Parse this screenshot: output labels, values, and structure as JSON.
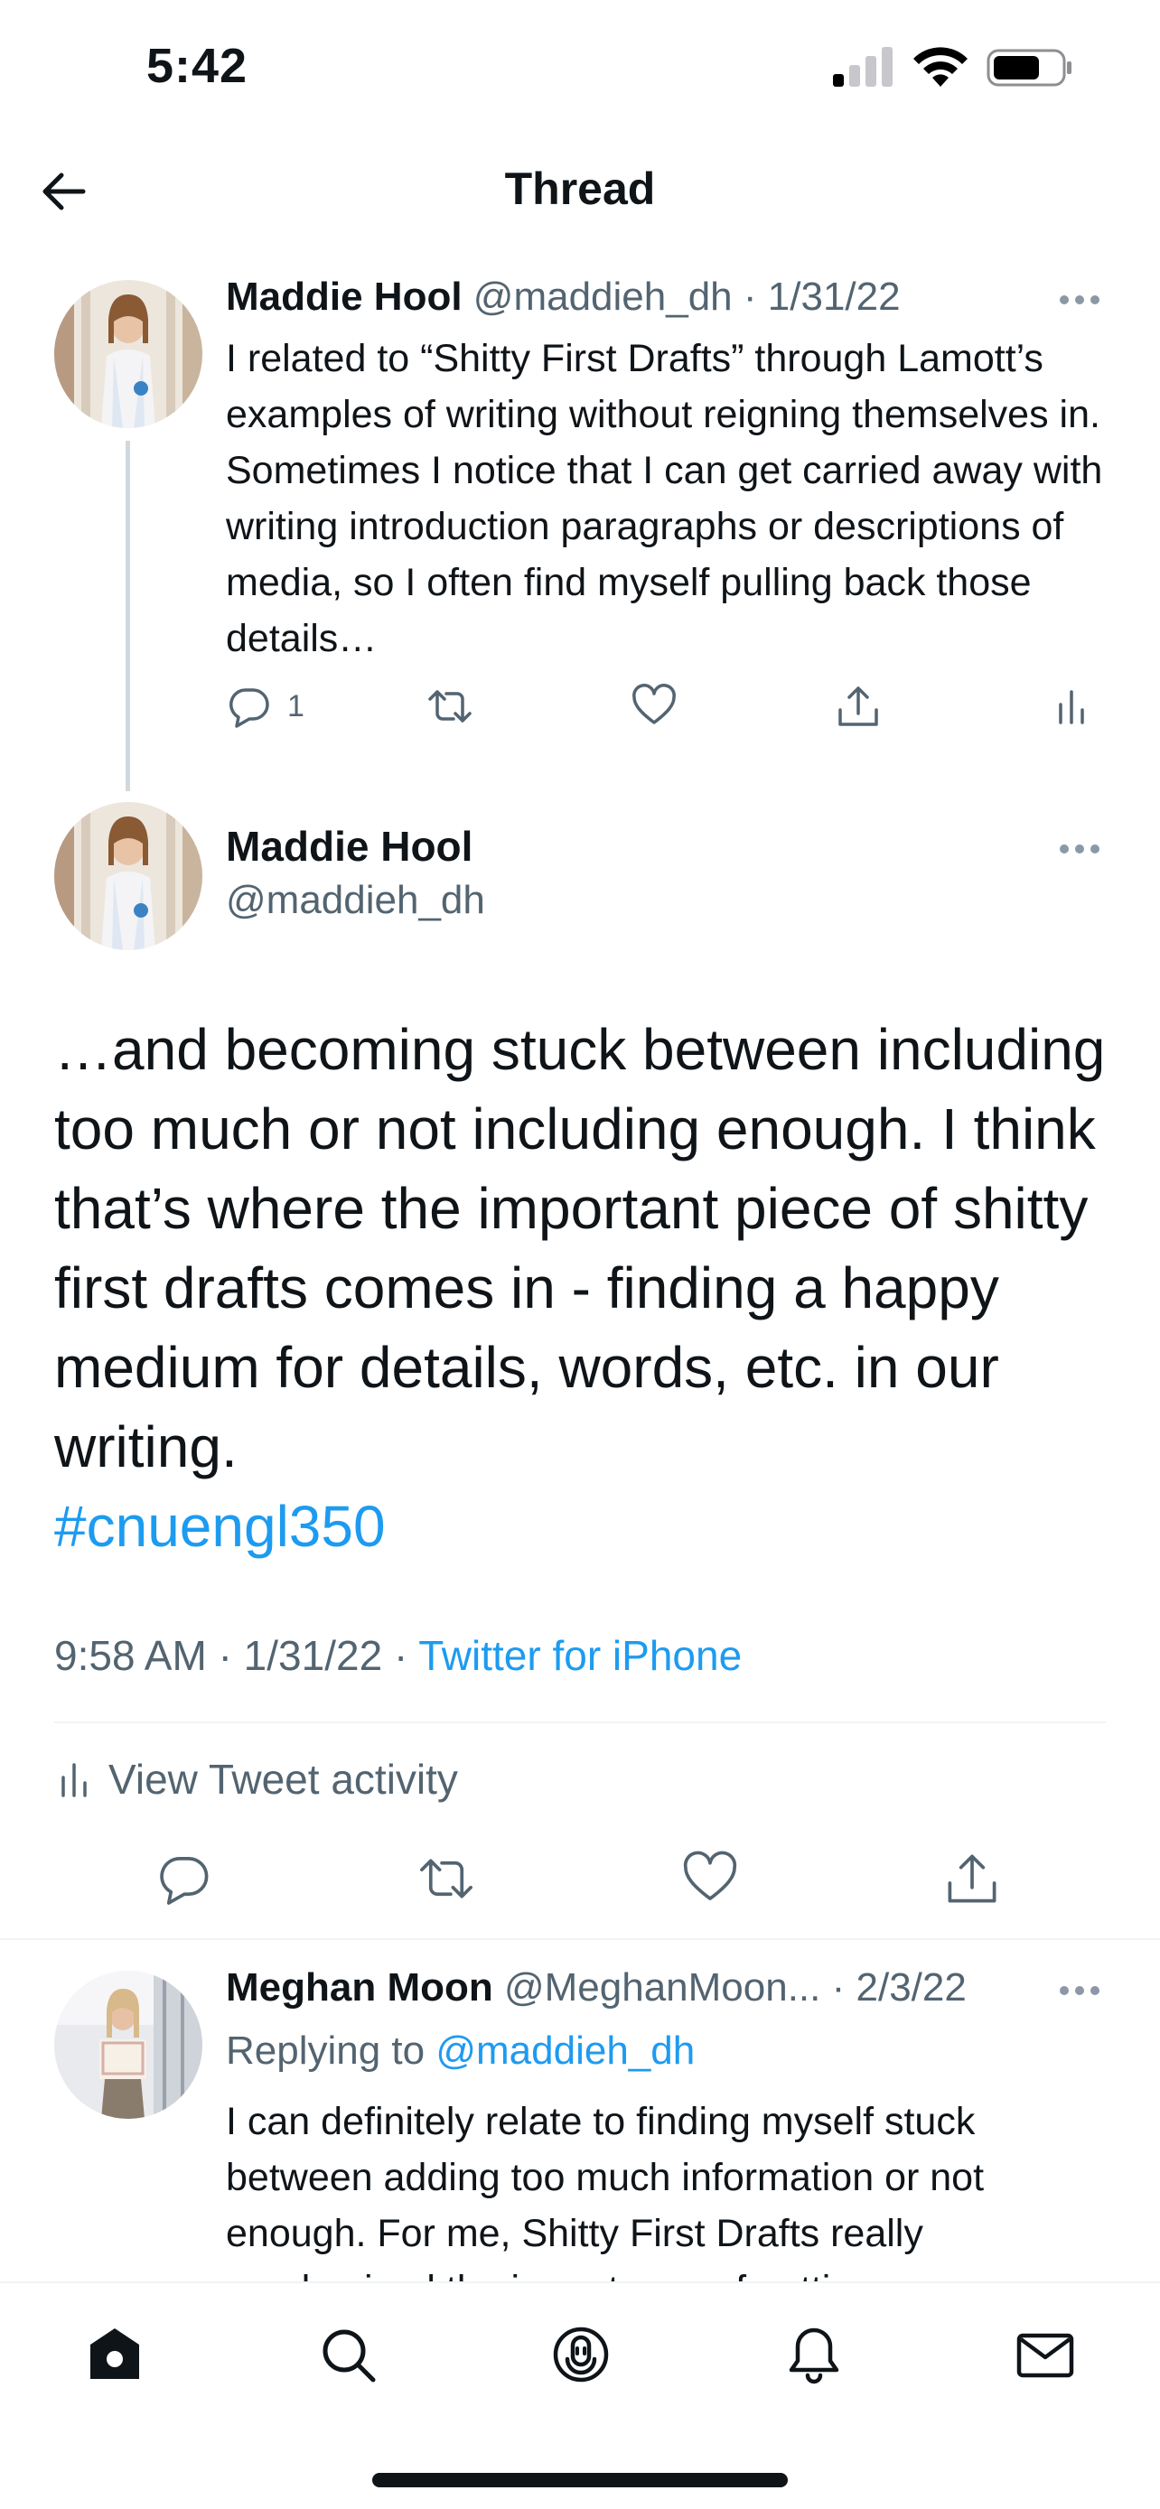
{
  "status_bar": {
    "time": "5:42"
  },
  "nav": {
    "title": "Thread"
  },
  "tweet1": {
    "name": "Maddie Hool",
    "handle": "@maddieh_dh",
    "sep": "·",
    "date": "1/31/22",
    "body": "I related to “Shitty First Drafts” through Lamott’s examples of writing without reigning themselves in. Sometimes I notice that I can get carried away with writing introduction paragraphs or descriptions of media, so I often find myself pulling back those details…",
    "reply_count": "1"
  },
  "tweet2": {
    "name": "Maddie Hool",
    "handle": "@maddieh_dh",
    "body": "…and becoming stuck between including too much or not including enough. I think that’s where the important piece of shitty first drafts comes in - finding a happy medium for details, words, etc. in our writing.",
    "hashtag": "#cnuengl350",
    "time": "9:58 AM",
    "sep": "·",
    "date": "1/31/22",
    "source": "Twitter for iPhone",
    "activity_label": "View Tweet activity"
  },
  "reply": {
    "name": "Meghan Moon",
    "handle": "@MeghanMoon...",
    "sep": "·",
    "date": "2/3/22",
    "replying_prefix": "Replying to ",
    "replying_to": "@maddieh_dh",
    "body": "I can definitely relate to finding myself stuck between adding too much information or not enough. For me, Shitty First Drafts really emphasized the importance of getting"
  },
  "colors": {
    "accent": "#1d9bf0",
    "text": "#0f1419",
    "secondary": "#536471",
    "divider": "#eff3f4"
  },
  "icons": {
    "tweet_actions": [
      "reply-icon",
      "retweet-icon",
      "like-icon",
      "share-icon",
      "analytics-icon"
    ],
    "tabbar": [
      "home-icon",
      "search-icon",
      "spaces-icon",
      "notifications-icon",
      "messages-icon"
    ]
  }
}
